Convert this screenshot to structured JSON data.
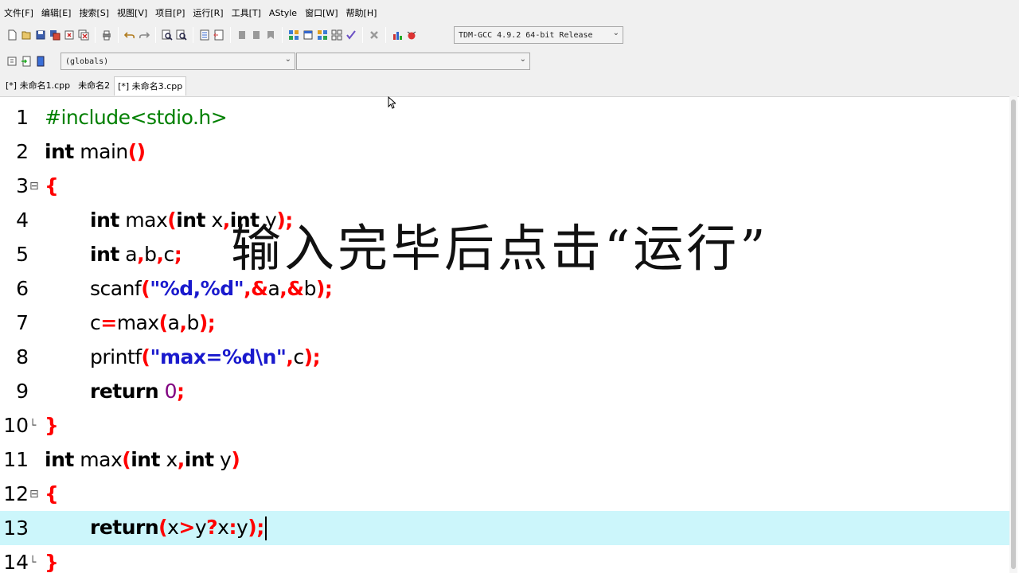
{
  "menu": [
    "文件[F]",
    "编辑[E]",
    "搜索[S]",
    "视图[V]",
    "项目[P]",
    "运行[R]",
    "工具[T]",
    "AStyle",
    "窗口[W]",
    "帮助[H]"
  ],
  "compiler_select": "TDM-GCC 4.9.2 64-bit Release",
  "scope_select": "(globals)",
  "symbol_select": "",
  "tabs": [
    "[*] 未命名1.cpp",
    "未命名2",
    "[*] 未命名3.cpp"
  ],
  "active_tab": 2,
  "code_lines": [
    {
      "n": "1"
    },
    {
      "n": "2"
    },
    {
      "n": "3"
    },
    {
      "n": "4"
    },
    {
      "n": "5"
    },
    {
      "n": "6"
    },
    {
      "n": "7"
    },
    {
      "n": "8"
    },
    {
      "n": "9"
    },
    {
      "n": "10"
    },
    {
      "n": "11"
    },
    {
      "n": "12"
    },
    {
      "n": "13"
    },
    {
      "n": "14"
    }
  ],
  "code_text": {
    "l1_pre": "#include<stdio.h>",
    "l2_kw": "int",
    "l2_rest": " main",
    "l2_p": "()",
    "l3_b": "{",
    "l4_kw1": "int",
    "l4_a": " max",
    "l4_p1": "(",
    "l4_kw2": "int",
    "l4_b": " x",
    "l4_c": ",",
    "l4_kw3": "int",
    "l4_d": " y",
    "l4_p2": ");",
    "l5_kw": "int",
    "l5_a": " a",
    "l5_c1": ",",
    "l5_b": "b",
    "l5_c2": ",",
    "l5_c": "c",
    "l5_s": ";",
    "l6_a": "scanf",
    "l6_p1": "(",
    "l6_str": "\"%d,%d\"",
    "l6_c1": ",&",
    "l6_b": "a",
    "l6_c2": ",&",
    "l6_c": "b",
    "l6_p2": ");",
    "l7_a": "c",
    "l7_eq": "=",
    "l7_b": "max",
    "l7_p1": "(",
    "l7_c": "a",
    "l7_cm": ",",
    "l7_d": "b",
    "l7_p2": ");",
    "l8_a": "printf",
    "l8_p1": "(",
    "l8_str": "\"max=%d\\n\"",
    "l8_cm": ",",
    "l8_b": "c",
    "l8_p2": ");",
    "l9_kw": "return",
    "l9_num": " 0",
    "l9_s": ";",
    "l10_b": "}",
    "l11_kw1": "int",
    "l11_a": " max",
    "l11_p1": "(",
    "l11_kw2": "int",
    "l11_b": " x",
    "l11_cm": ",",
    "l11_kw3": "int",
    "l11_c": " y",
    "l11_p2": ")",
    "l12_b": "{",
    "l13_kw": "return",
    "l13_p1": "(",
    "l13_a": "x",
    "l13_gt": ">",
    "l13_b": "y",
    "l13_q": "?",
    "l13_c": "x",
    "l13_col": ":",
    "l13_d": "y",
    "l13_p2": ");",
    "l14_b": "}"
  },
  "overlay_text": "输入完毕后点击“运行”",
  "colors": {
    "current_line": "#ccf6fb",
    "keyword": "#000000",
    "preprocessor": "#008000",
    "string": "#1a1acd",
    "symbol": "#ff0000",
    "number": "#800080"
  },
  "icons": [
    "new-file-icon",
    "open-file-icon",
    "save-icon",
    "save-all-icon",
    "close-icon",
    "close-all-icon",
    "print-icon",
    "undo-icon",
    "redo-icon",
    "find-icon",
    "replace-icon",
    "indent-icon",
    "unindent-icon",
    "bookmark-icon",
    "goto-icon",
    "compile-icon",
    "run-icon",
    "compile-run-icon",
    "rebuild-icon",
    "check-icon",
    "stop-icon",
    "chart-icon",
    "debug-icon",
    "new-project-icon",
    "add-file-icon",
    "remove-file-icon"
  ]
}
